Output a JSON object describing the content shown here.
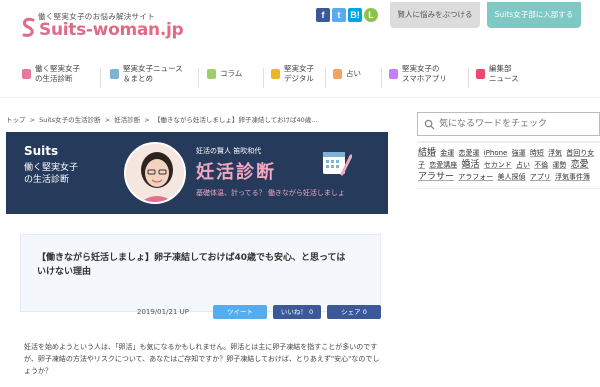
{
  "header": {
    "tagline": "働く堅実女子のお悩み解決サイト",
    "logo_text": "Suits-woman.jp",
    "social": [
      {
        "icon": "facebook-icon",
        "glyph": "f",
        "color": "#3b5998"
      },
      {
        "icon": "twitter-icon",
        "glyph": "t",
        "color": "#55acee"
      },
      {
        "icon": "hatena-icon",
        "glyph": "B!",
        "color": "#00a4de"
      },
      {
        "icon": "line-icon",
        "glyph": "L",
        "color": "#8bc34a"
      }
    ],
    "ask_button": "賢人に悩みをぶつける",
    "join_button": "Suits女子部に入部する"
  },
  "nav": {
    "items": [
      {
        "label": "働く堅実女子\nの生活診断",
        "icon": "diagnosis-icon",
        "color": "#e7789b"
      },
      {
        "label": "堅実女子ニュース\n＆まとめ",
        "icon": "news-icon",
        "color": "#7fb3d5"
      },
      {
        "label": "コラム",
        "icon": "column-icon",
        "color": "#9fcf6a"
      },
      {
        "label": "堅実女子\nデジタル",
        "icon": "digital-icon",
        "color": "#f0b429"
      },
      {
        "label": "占い",
        "icon": "fortune-icon",
        "color": "#f4a261"
      },
      {
        "label": "堅実女子の\nスマホアプリ",
        "icon": "smartphone-icon",
        "color": "#c77dff"
      },
      {
        "label": "編集部\nニュース",
        "icon": "editorial-icon",
        "color": "#ef476f"
      }
    ]
  },
  "breadcrumb": [
    "トップ",
    ">",
    "Suits女子の生活診断",
    ">",
    "妊活診断",
    ">",
    "【働きながら妊活しましょ】卵子凍結しておけば40歳..."
  ],
  "banner": {
    "brand": "Suits",
    "subtitle_line1": "働く堅実女子",
    "subtitle_line2": "の生活診断",
    "by": "妊活の賢人 笛吹和代",
    "title": "妊活診断",
    "question": "基礎体温、計ってる？ 働きながら妊活しましょ"
  },
  "article": {
    "title": "【働きながら妊活しましょ】卵子凍結しておけば40歳でも安心、と思っては いけない理由",
    "date": "2019/01/21 UP",
    "tweet": "ツイート",
    "like": "いいね！ 0",
    "share": "シェア 0",
    "body": "妊活を始めようという人は、「卵活」も気になるかもしれません。卵活とは主に卵子凍結を指すことが多いのですが、卵子凍結の方法やリスクについて、あなたはご存知ですか？卵子凍結しておけば、とりあえず\"安心\"なのでしょうか？"
  },
  "sidebar": {
    "search_placeholder": "気になるワードをチェック",
    "tags": [
      {
        "t": "結婚",
        "big": true
      },
      {
        "t": "金運"
      },
      {
        "t": "恋愛運"
      },
      {
        "t": "iPhone"
      },
      {
        "t": "強運"
      },
      {
        "t": "時短"
      },
      {
        "t": "浮気"
      },
      {
        "t": "首回り女子"
      },
      {
        "t": "恋愛講座"
      },
      {
        "t": "婚活",
        "big": true
      },
      {
        "t": "セカンド"
      },
      {
        "t": "占い"
      },
      {
        "t": "不倫"
      },
      {
        "t": "運勢"
      },
      {
        "t": "恋愛",
        "big": true
      },
      {
        "t": "アラサー",
        "big": true
      },
      {
        "t": "アラフォー"
      },
      {
        "t": "美人探偵"
      },
      {
        "t": "アプリ"
      },
      {
        "t": "浮気事件簿"
      }
    ]
  }
}
